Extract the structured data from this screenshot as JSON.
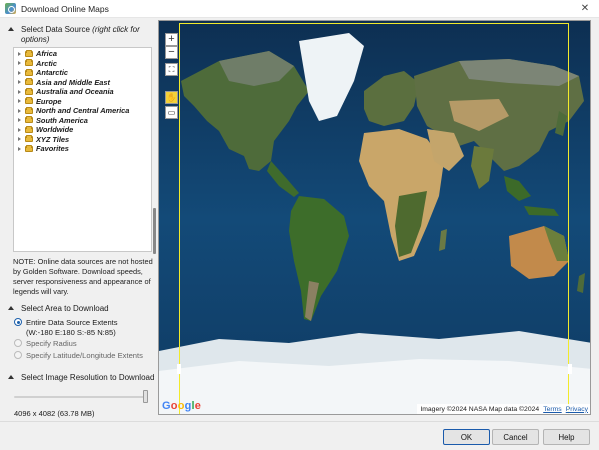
{
  "window": {
    "title": "Download Online Maps",
    "close_glyph": "✕"
  },
  "left": {
    "data_source": {
      "header": "Select Data Source",
      "hint": "(right click for options)",
      "items": [
        {
          "label": "Africa"
        },
        {
          "label": "Arctic"
        },
        {
          "label": "Antarctic"
        },
        {
          "label": "Asia and Middle East"
        },
        {
          "label": "Australia and Oceania"
        },
        {
          "label": "Europe"
        },
        {
          "label": "North and Central America"
        },
        {
          "label": "South America"
        },
        {
          "label": "Worldwide"
        },
        {
          "label": "XYZ Tiles"
        },
        {
          "label": "Favorites"
        }
      ]
    },
    "note": "NOTE: Online data sources are not hosted by Golden Software. Download speeds, server responsiveness and appearance of legends will vary.",
    "area": {
      "header": "Select Area to Download",
      "options": [
        {
          "label": "Entire Data Source Extents",
          "sub": "(W:-180 E:180 S:-85 N:85)",
          "selected": true
        },
        {
          "label": "Specify Radius",
          "selected": false
        },
        {
          "label": "Specify Latitude/Longitude Extents",
          "selected": false
        }
      ]
    },
    "resolution": {
      "header": "Select Image Resolution to Download",
      "slider_fraction": 1.0,
      "value_text": "4096 x 4082  (63.78 MB)"
    }
  },
  "map": {
    "zoom_in": "+",
    "zoom_out": "−",
    "fit": "⛶",
    "pan_tool": "✋",
    "select_tool": "▭",
    "logo_letters": [
      "G",
      "o",
      "o",
      "g",
      "l",
      "e"
    ],
    "attribution": "Imagery ©2024 NASA Map data ©2024",
    "terms": "Terms",
    "privacy": "Privacy",
    "colors": {
      "ocean": "#0f3a5e",
      "selection": "#f2ea2b"
    }
  },
  "buttons": {
    "ok": "OK",
    "cancel": "Cancel",
    "help": "Help"
  }
}
